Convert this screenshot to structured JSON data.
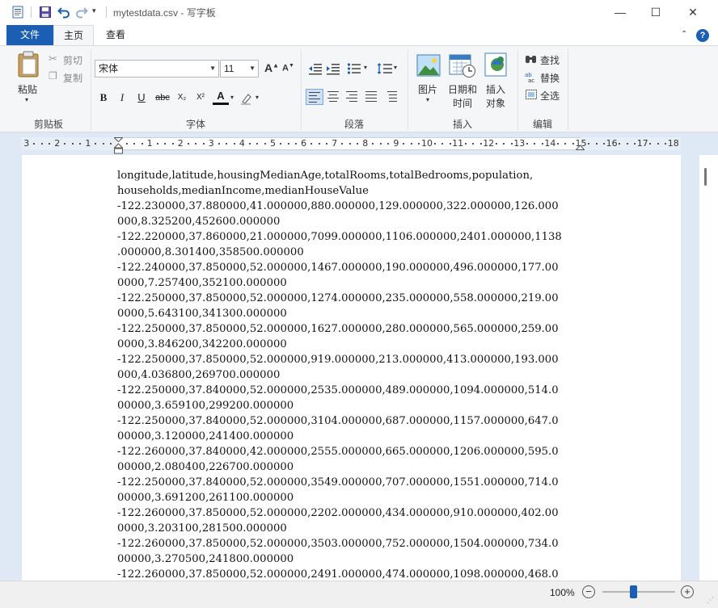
{
  "window": {
    "title": "mytestdata.csv - 写字板",
    "minimize": "—",
    "maximize": "☐",
    "close": "✕"
  },
  "ribbon_tabs": [
    "文件",
    "主页",
    "查看"
  ],
  "ribbon": {
    "clipboard": {
      "paste": "粘贴",
      "cut": "剪切",
      "copy": "复制",
      "group": "剪贴板"
    },
    "font": {
      "name": "宋体",
      "size": "11",
      "bold": "B",
      "italic": "I",
      "underline": "U",
      "strike": "abc",
      "subscript": "X₂",
      "superscript": "X²",
      "color": "A",
      "group": "字体"
    },
    "paragraph": {
      "group": "段落"
    },
    "insert": {
      "picture": "图片",
      "datetime_1": "日期和",
      "datetime_2": "时间",
      "object_1": "插入",
      "object_2": "对象",
      "group": "插入"
    },
    "edit": {
      "find": "查找",
      "replace": "替换",
      "select_all": "全选",
      "group": "编辑"
    }
  },
  "ruler": {
    "labels": [
      "3",
      "2",
      "1",
      "1",
      "2",
      "3",
      "4",
      "5",
      "6",
      "7",
      "8",
      "9",
      "10",
      "11",
      "12",
      "13",
      "14",
      "15",
      "16",
      "17",
      "18"
    ]
  },
  "document": {
    "lines": [
      "longitude,latitude,housingMedianAge,totalRooms,totalBedrooms,population,",
      "households,medianIncome,medianHouseValue",
      "-122.230000,37.880000,41.000000,880.000000,129.000000,322.000000,126.000",
      "000,8.325200,452600.000000",
      "-122.220000,37.860000,21.000000,7099.000000,1106.000000,2401.000000,1138",
      ".000000,8.301400,358500.000000",
      "-122.240000,37.850000,52.000000,1467.000000,190.000000,496.000000,177.00",
      "0000,7.257400,352100.000000",
      "-122.250000,37.850000,52.000000,1274.000000,235.000000,558.000000,219.00",
      "0000,5.643100,341300.000000",
      "-122.250000,37.850000,52.000000,1627.000000,280.000000,565.000000,259.00",
      "0000,3.846200,342200.000000",
      "-122.250000,37.850000,52.000000,919.000000,213.000000,413.000000,193.000",
      "000,4.036800,269700.000000",
      "-122.250000,37.840000,52.000000,2535.000000,489.000000,1094.000000,514.0",
      "00000,3.659100,299200.000000",
      "-122.250000,37.840000,52.000000,3104.000000,687.000000,1157.000000,647.0",
      "00000,3.120000,241400.000000",
      "-122.260000,37.840000,42.000000,2555.000000,665.000000,1206.000000,595.0",
      "00000,2.080400,226700.000000",
      "-122.250000,37.840000,52.000000,3549.000000,707.000000,1551.000000,714.0",
      "00000,3.691200,261100.000000",
      "-122.260000,37.850000,52.000000,2202.000000,434.000000,910.000000,402.00",
      "0000,3.203100,281500.000000",
      "-122.260000,37.850000,52.000000,3503.000000,752.000000,1504.000000,734.0",
      "00000,3.270500,241800.000000",
      "-122.260000,37.850000,52.000000,2491.000000,474.000000,1098.000000,468.0"
    ]
  },
  "status": {
    "zoom": "100%",
    "zoom_level": 0.43,
    "zoom_out": "−",
    "zoom_in": "+"
  },
  "colors": {
    "accent": "#1a5fb4",
    "doc_background": "#dfe9f5"
  }
}
